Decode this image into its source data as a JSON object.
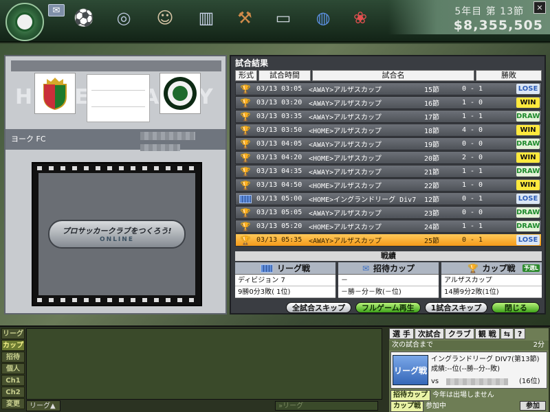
{
  "header": {
    "season": "5年目 第 13節",
    "money": "8,355,505",
    "currency_symbol": "$"
  },
  "nav_icons": [
    "mail-icon",
    "soccer-ball-icon",
    "stadium-icon",
    "manager-icon",
    "building-icon",
    "auction-gavel-icon",
    "computer-icon",
    "globe-icon",
    "gift-icon"
  ],
  "match": {
    "home_watermark": "HOME",
    "away_watermark": "AWAY",
    "home_team": "ヨーク FC",
    "promo_line1": "プロサッカークラブをつくろう!",
    "promo_line2": "ONLINE"
  },
  "results": {
    "title": "試合結果",
    "headers": [
      "形式",
      "試合時間",
      "試合名",
      "勝敗"
    ],
    "rows": [
      {
        "type": "cup",
        "datetime": "03/13 03:05",
        "name": "<AWAY>アルザスカップ",
        "round": "15節",
        "score": "0 - 1",
        "result": "LOSE"
      },
      {
        "type": "cup",
        "datetime": "03/13 03:20",
        "name": "<AWAY>アルザスカップ",
        "round": "16節",
        "score": "1 - 0",
        "result": "WIN"
      },
      {
        "type": "cup",
        "datetime": "03/13 03:35",
        "name": "<AWAY>アルザスカップ",
        "round": "17節",
        "score": "1 - 1",
        "result": "DRAW"
      },
      {
        "type": "cup",
        "datetime": "03/13 03:50",
        "name": "<HOME>アルザスカップ",
        "round": "18節",
        "score": "4 - 0",
        "result": "WIN"
      },
      {
        "type": "cup",
        "datetime": "03/13 04:05",
        "name": "<AWAY>アルザスカップ",
        "round": "19節",
        "score": "0 - 0",
        "result": "DRAW"
      },
      {
        "type": "cup",
        "datetime": "03/13 04:20",
        "name": "<HOME>アルザスカップ",
        "round": "20節",
        "score": "2 - 0",
        "result": "WIN"
      },
      {
        "type": "cup",
        "datetime": "03/13 04:35",
        "name": "<AWAY>アルザスカップ",
        "round": "21節",
        "score": "1 - 1",
        "result": "DRAW"
      },
      {
        "type": "cup",
        "datetime": "03/13 04:50",
        "name": "<HOME>アルザスカップ",
        "round": "22節",
        "score": "1 - 0",
        "result": "WIN"
      },
      {
        "type": "league",
        "datetime": "03/13 05:00",
        "name": "<HOME>イングランドリーグ Div7",
        "round": "12節",
        "score": "0 - 1",
        "result": "LOSE"
      },
      {
        "type": "cup",
        "datetime": "03/13 05:05",
        "name": "<AWAY>アルザスカップ",
        "round": "23節",
        "score": "0 - 0",
        "result": "DRAW"
      },
      {
        "type": "cup",
        "datetime": "03/13 05:20",
        "name": "<HOME>アルザスカップ",
        "round": "24節",
        "score": "1 - 1",
        "result": "DRAW"
      },
      {
        "type": "cup",
        "datetime": "03/13 05:35",
        "name": "<AWAY>アルザスカップ",
        "round": "25節",
        "score": "0 - 1",
        "result": "LOSE",
        "selected": true
      }
    ]
  },
  "summary": {
    "title": "戦績",
    "league": {
      "label": "リーグ戦",
      "line1": "ディビジョン 7",
      "line2": "9勝0分3敗( 1位)"
    },
    "invite_cup": {
      "label": "招待カップ",
      "line1": "－",
      "line2": "－勝－分－敗(－位)"
    },
    "cup": {
      "label": "カップ戦",
      "badge": "予選L",
      "line1": "アルザスカップ",
      "line2": "14勝9分2敗(1位)"
    }
  },
  "buttons": {
    "skip_all": "全試合スキップ",
    "full_replay": "フルゲーム再生",
    "skip_one": "1試合スキップ",
    "close": "閉じる"
  },
  "chat": {
    "tabs": [
      "リーグ",
      "カップ",
      "招待",
      "個人",
      "Ch1",
      "Ch2",
      "変更"
    ],
    "mode": "リーグ▲",
    "input_placeholder": "»リーグ"
  },
  "info": {
    "tabs": [
      "選 手",
      "次試合",
      "クラブ",
      "観 戦",
      "⇆",
      "?"
    ],
    "next_match_label": "次の試合まで",
    "next_match_count": "2分",
    "league_badge": "リーグ戦",
    "league_name": "イングランドリーグ DIV7(第13節)",
    "record": "成績:--位(--勝--分--敗)",
    "vs_label": "vs",
    "opponent_rank": "(16位)",
    "invite_cup_tag": "招待カップ",
    "invite_cup_text": "今年は出場しません",
    "cup_tag": "カップ戦",
    "cup_text": "参加中",
    "join_button": "参加"
  },
  "colors": {
    "win": "#ffe93d",
    "lose": "#2c5cb8",
    "draw": "#1d8a2c",
    "selected_row": "#f49a1a"
  }
}
